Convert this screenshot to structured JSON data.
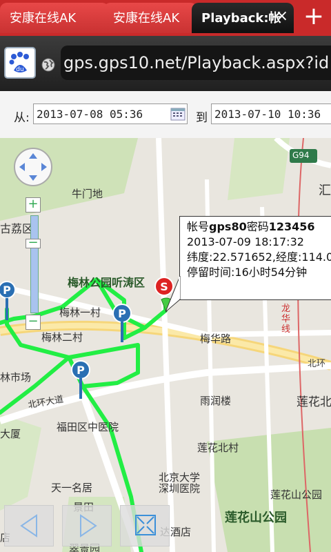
{
  "tabs": [
    {
      "label": "安康在线AK"
    },
    {
      "label": "安康在线AK"
    },
    {
      "label": "Playback:帐"
    }
  ],
  "toolbar": {
    "close_symbol": "×",
    "new_tab_symbol": "+"
  },
  "url": {
    "value": "gps.gps10.net/Playback.aspx?id"
  },
  "search": {
    "from_label": "从:",
    "from_value": "2013-07-08 05:36",
    "to_label": "到",
    "to_value": "2013-07-10 10:36"
  },
  "popup": {
    "account_prefix": "帐号",
    "account": "gps80",
    "password_prefix": "密码",
    "password": "123456",
    "datetime": "2013-07-09 18:17:32",
    "coords": "纬度:22.571652,经度:114.0",
    "stay": "停留时间:16小时54分钟"
  },
  "map": {
    "labels": [
      "牛门地",
      "梅林公园听涛区",
      "梅林一村",
      "梅林二村",
      "梅华路",
      "林市场",
      "北环大道",
      "福田区中医院",
      "雨润楼",
      "莲花北",
      "大厦",
      "莲花北村",
      "天一名居",
      "北京大学深圳医院",
      "莲花山公园",
      "景田",
      "达酒店",
      "翠景园",
      "莲花山公园",
      "龙华线",
      "北环",
      "G94",
      "古荔区",
      "汇",
      "店"
    ],
    "start_marker": "S",
    "parking_marker": "P",
    "zoom_in": "+",
    "zoom_out": "−",
    "route_color": "#22ee44"
  },
  "colors": {
    "tab_red": "#c92a2a",
    "active_tab": "#101010",
    "route": "#22ee44",
    "marker_blue": "#2a6fb3",
    "start_red": "#dd2222"
  }
}
